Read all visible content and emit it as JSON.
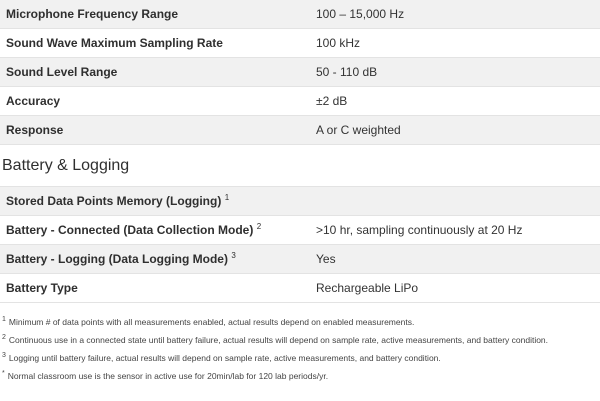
{
  "top_specs": [
    {
      "label": "Microphone Frequency Range",
      "value": "100 – 15,000 Hz"
    },
    {
      "label": "Sound Wave Maximum Sampling Rate",
      "value": "100 kHz"
    },
    {
      "label": "Sound Level Range",
      "value": "50 - 110 dB"
    },
    {
      "label": "Accuracy",
      "value": "±2 dB"
    },
    {
      "label": "Response",
      "value": "A or C weighted"
    }
  ],
  "battery_section": {
    "heading": "Battery & Logging",
    "rows": [
      {
        "label": "Stored Data Points Memory (Logging)",
        "sup": "1",
        "value": ""
      },
      {
        "label": "Battery - Connected (Data Collection Mode)",
        "sup": "2",
        "value": ">10 hr, sampling continuously at 20 Hz"
      },
      {
        "label": "Battery - Logging (Data Logging Mode)",
        "sup": "3",
        "value": "Yes"
      },
      {
        "label": "Battery Type",
        "sup": "",
        "value": "Rechargeable LiPo"
      }
    ]
  },
  "footnotes": [
    {
      "marker": "1",
      "text": "Minimum # of data points with all measurements enabled, actual results depend on enabled measurements."
    },
    {
      "marker": "2",
      "text": "Continuous use in a connected state until battery failure, actual results will depend on sample rate, active measurements, and battery condition."
    },
    {
      "marker": "3",
      "text": "Logging until battery failure, actual results will depend on sample rate, active measurements, and battery condition."
    },
    {
      "marker": "*",
      "text": "Normal classroom use is the sensor in active use for 20min/lab for 120 lab periods/yr."
    }
  ]
}
